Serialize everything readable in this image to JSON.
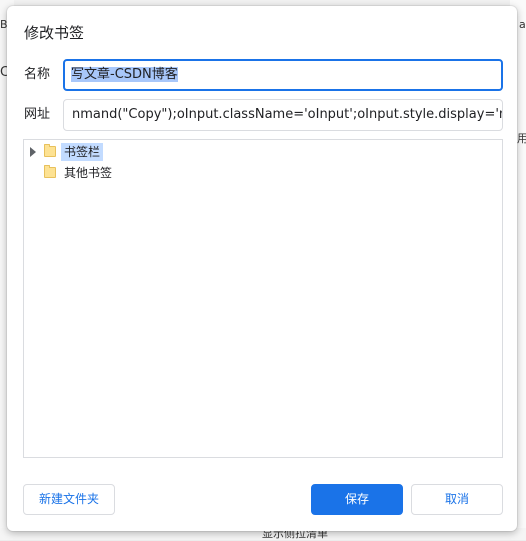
{
  "background": {
    "fragments": {
      "top_left": "B",
      "mid_left": "C",
      "top_right": "a",
      "right_edge": "用",
      "bottom_text": "显示侧拉清单"
    }
  },
  "dialog": {
    "title": "修改书签",
    "name": {
      "label": "名称",
      "value": "写文章-CSDN博客"
    },
    "url": {
      "label": "网址",
      "value": "nmand(\"Copy\");oInput.className='oInput';oInput.style.display='none';})()"
    },
    "tree": {
      "items": [
        {
          "label": "书签栏",
          "has_children": true,
          "selected": true
        },
        {
          "label": "其他书签",
          "has_children": false,
          "selected": false
        }
      ]
    },
    "buttons": {
      "new_folder": "新建文件夹",
      "save": "保存",
      "cancel": "取消"
    }
  },
  "colors": {
    "accent": "#1a73e8",
    "selection": "#a8c7fa",
    "tree_selection": "#c2dbff",
    "folder": "#fde293"
  }
}
